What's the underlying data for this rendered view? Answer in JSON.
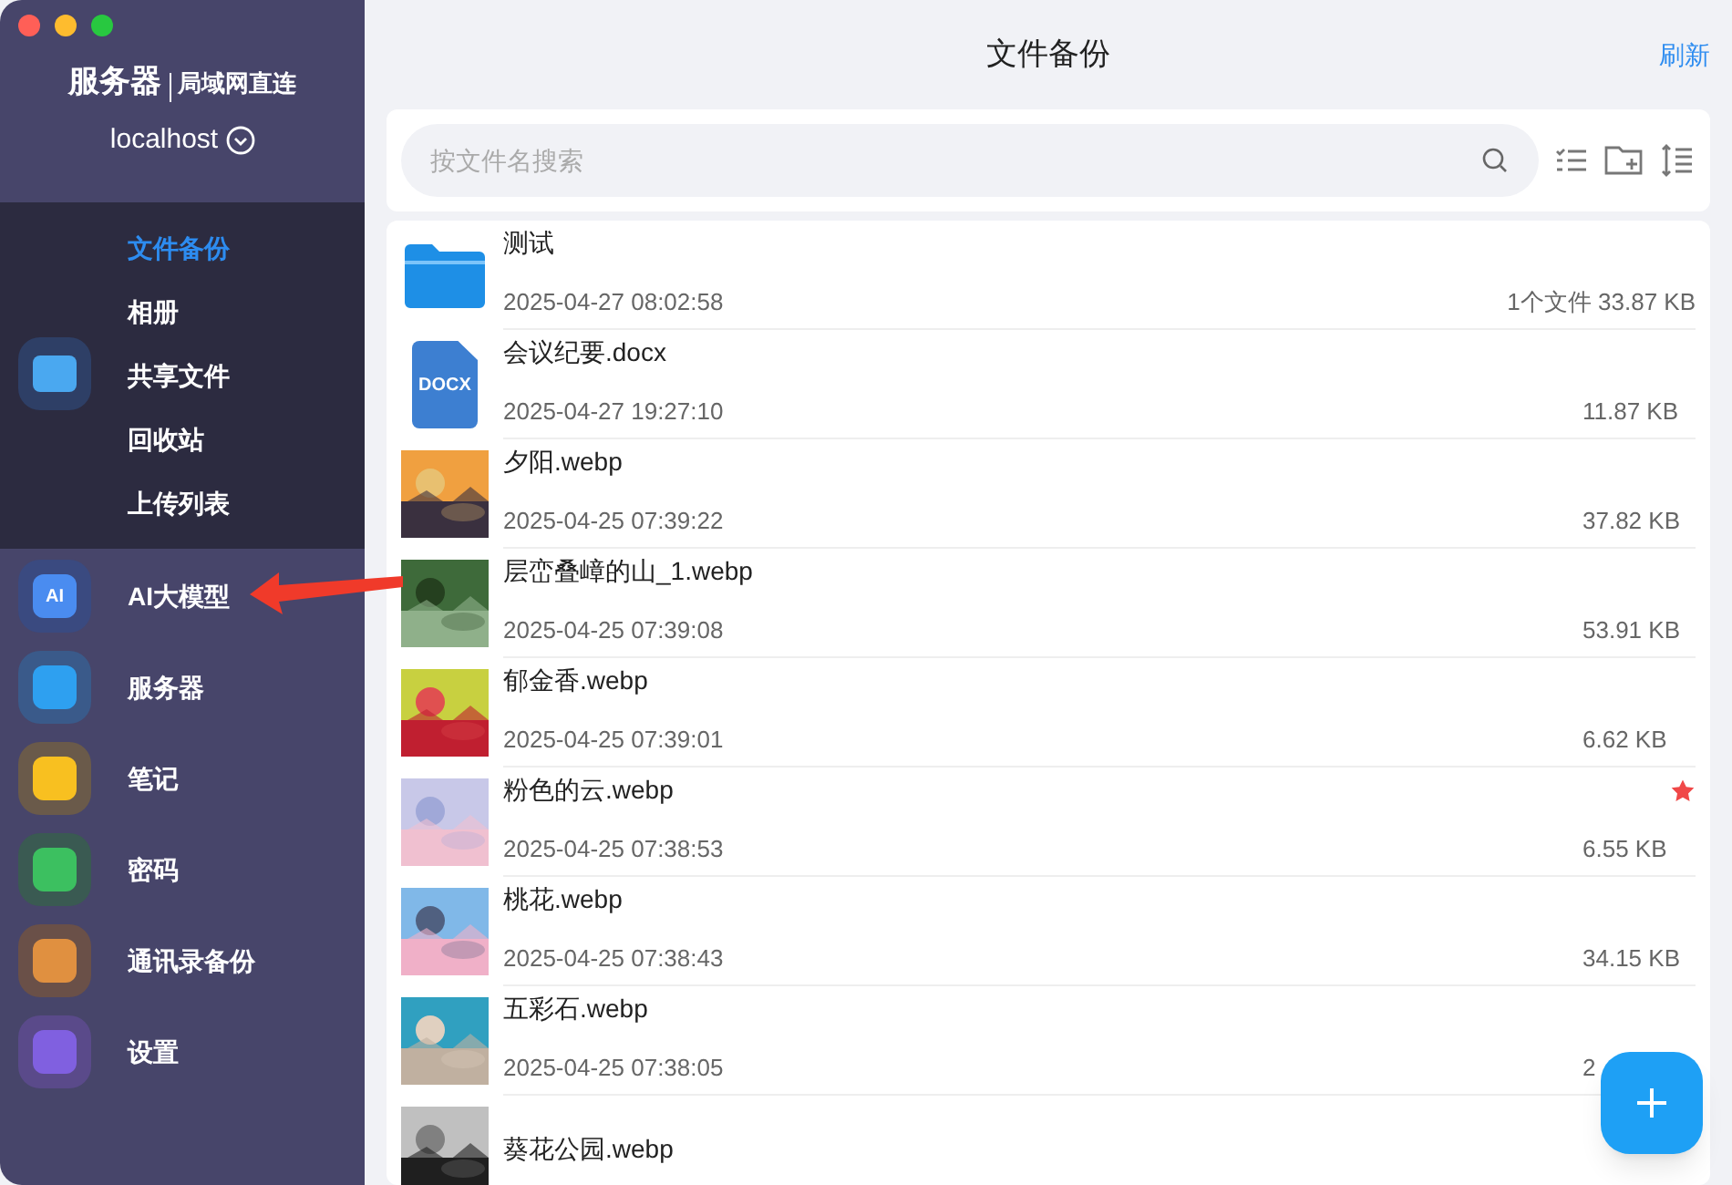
{
  "sidebar": {
    "title": "服务器",
    "subtitle": "局域网直连",
    "host": "localhost",
    "group": {
      "expanded": true,
      "children": [
        {
          "label": "文件备份",
          "selected": true
        },
        {
          "label": "相册",
          "selected": false
        },
        {
          "label": "共享文件",
          "selected": false
        },
        {
          "label": "回收站",
          "selected": false
        },
        {
          "label": "上传列表",
          "selected": false
        }
      ]
    },
    "items": [
      {
        "label": "AI大模型",
        "icon_text": "AI"
      },
      {
        "label": "服务器"
      },
      {
        "label": "笔记"
      },
      {
        "label": "密码"
      },
      {
        "label": "通讯录备份"
      },
      {
        "label": "设置"
      }
    ]
  },
  "header": {
    "title": "文件备份",
    "action": "刷新"
  },
  "search": {
    "placeholder": "按文件名搜索"
  },
  "files": [
    {
      "kind": "folder",
      "name": "测试",
      "time": "2025-04-27 08:02:58",
      "size": "1个文件 33.87 KB",
      "starred": false
    },
    {
      "kind": "docx",
      "badge": "DOCX",
      "name": "会议纪要.docx",
      "time": "2025-04-27 19:27:10",
      "size": "11.87 KB",
      "starred": false
    },
    {
      "kind": "picture",
      "name": "夕阳.webp",
      "time": "2025-04-25 07:39:22",
      "size": "37.82 KB",
      "starred": false
    },
    {
      "kind": "picture",
      "name": "层峦叠嶂的山_1.webp",
      "time": "2025-04-25 07:39:08",
      "size": "53.91 KB",
      "starred": false
    },
    {
      "kind": "picture",
      "name": "郁金香.webp",
      "time": "2025-04-25 07:39:01",
      "size": "6.62 KB",
      "starred": false
    },
    {
      "kind": "picture",
      "name": "粉色的云.webp",
      "time": "2025-04-25 07:38:53",
      "size": "6.55 KB",
      "starred": true
    },
    {
      "kind": "picture",
      "name": "桃花.webp",
      "time": "2025-04-25 07:38:43",
      "size": "34.15 KB",
      "starred": false
    },
    {
      "kind": "picture",
      "name": "五彩石.webp",
      "time": "2025-04-25 07:38:05",
      "size": "2",
      "starred": false
    },
    {
      "kind": "picture",
      "name": "葵花公园.webp",
      "starred": false
    }
  ]
}
